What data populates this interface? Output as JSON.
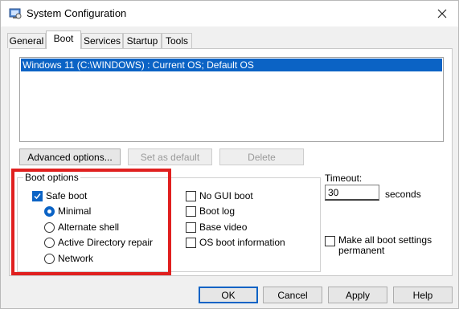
{
  "window": {
    "title": "System Configuration"
  },
  "tabs": [
    {
      "label": "General"
    },
    {
      "label": "Boot"
    },
    {
      "label": "Services"
    },
    {
      "label": "Startup"
    },
    {
      "label": "Tools"
    }
  ],
  "os_list": {
    "entries": [
      "Windows 11 (C:\\WINDOWS) : Current OS; Default OS"
    ]
  },
  "list_buttons": {
    "advanced": "Advanced options...",
    "set_default": "Set as default",
    "delete": "Delete"
  },
  "boot_options": {
    "label": "Boot options",
    "safe_boot": "Safe boot",
    "minimal": "Minimal",
    "alternate_shell": "Alternate shell",
    "active_directory_repair": "Active Directory repair",
    "network": "Network",
    "no_gui_boot": "No GUI boot",
    "boot_log": "Boot log",
    "base_video": "Base video",
    "os_boot_information": "OS boot information"
  },
  "timeout": {
    "label": "Timeout:",
    "value": "30",
    "unit": "seconds"
  },
  "permanent": {
    "line1": "Make all boot settings",
    "line2": "permanent"
  },
  "footer": {
    "ok": "OK",
    "cancel": "Cancel",
    "apply": "Apply",
    "help": "Help"
  },
  "colors": {
    "accent": "#0b63c5",
    "highlight_box": "#e0201f"
  }
}
